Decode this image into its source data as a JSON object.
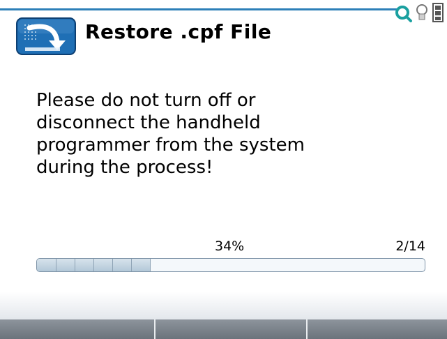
{
  "header": {
    "title": "Restore .cpf File",
    "icon": "restore-arrow-icon"
  },
  "status_icons": [
    "search-icon",
    "lightbulb-icon",
    "battery-icon"
  ],
  "message": "Please do not turn off or\ndisconnect the handheld\nprogrammer from the system\nduring the process!",
  "progress": {
    "percent_text": "34%",
    "step_text": "2/14",
    "fraction": 0.34
  },
  "softkeys": {
    "count": 3,
    "labels": [
      "",
      "",
      ""
    ]
  },
  "colors": {
    "accent": "#2c7fb8",
    "icon_blue": "#1f6fb5",
    "softkey_bar": "#7b838b"
  }
}
